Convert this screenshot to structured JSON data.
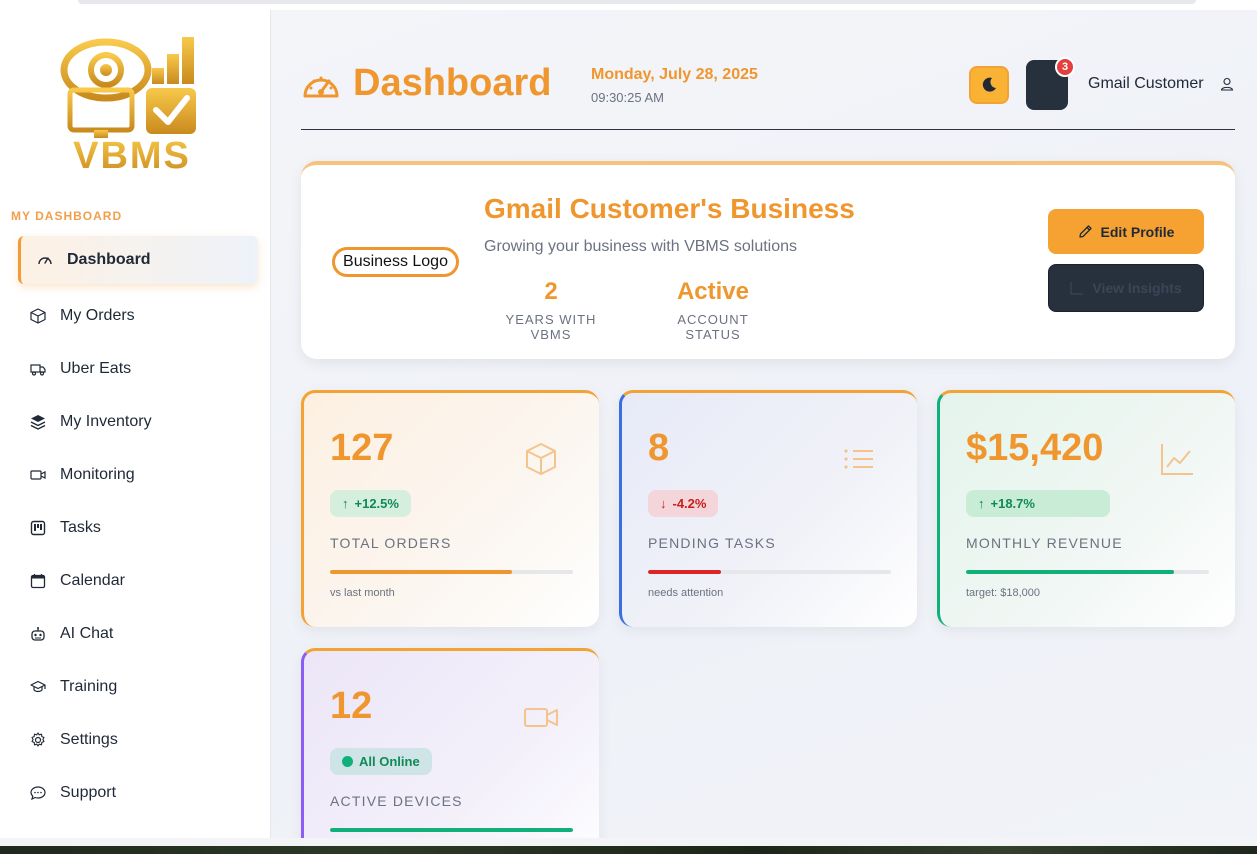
{
  "brand": {
    "name": "VBMS"
  },
  "sidebar": {
    "section_title": "MY DASHBOARD",
    "items": [
      {
        "label": "Dashboard",
        "icon": "gauge-icon",
        "active": true
      },
      {
        "label": "My Orders",
        "icon": "box-icon"
      },
      {
        "label": "Uber Eats",
        "icon": "truck-icon"
      },
      {
        "label": "My Inventory",
        "icon": "layers-icon"
      },
      {
        "label": "Monitoring",
        "icon": "video-icon"
      },
      {
        "label": "Tasks",
        "icon": "kanban-icon"
      },
      {
        "label": "Calendar",
        "icon": "calendar-icon"
      },
      {
        "label": "AI Chat",
        "icon": "robot-icon"
      },
      {
        "label": "Training",
        "icon": "graduation-cap-icon"
      },
      {
        "label": "Settings",
        "icon": "gear-icon"
      },
      {
        "label": "Support",
        "icon": "chat-bubble-icon"
      }
    ]
  },
  "header": {
    "title": "Dashboard",
    "date": "Monday, July 28, 2025",
    "time": "09:30:25 AM",
    "notification_count": "3",
    "user_name": "Gmail Customer"
  },
  "profile": {
    "logo_alt": "Business Logo",
    "business_name": "Gmail Customer's Business",
    "tagline": "Growing your business with VBMS solutions",
    "stats": [
      {
        "value": "2",
        "label": "YEARS WITH VBMS"
      },
      {
        "value": "Active",
        "label": "ACCOUNT STATUS"
      }
    ],
    "edit_label": "Edit Profile",
    "view_label": "View Insights"
  },
  "cards": {
    "orders": {
      "value": "127",
      "change": "+12.5%",
      "label": "TOTAL ORDERS",
      "sub": "vs last month",
      "progress": 0.75
    },
    "tasks": {
      "value": "8",
      "change": "-4.2%",
      "label": "PENDING TASKS",
      "sub": "needs attention",
      "progress": 0.3
    },
    "revenue": {
      "value": "$15,420",
      "change": "+18.7%",
      "label": "MONTHLY REVENUE",
      "sub": "target: $18,000",
      "progress": 0.857
    },
    "devices": {
      "value": "12",
      "badge": "All Online",
      "label": "ACTIVE DEVICES",
      "progress": 1.0
    }
  },
  "colors": {
    "accent": "#f0962e",
    "dark": "#27313d",
    "positive": "#10b07a",
    "negative": "#dc2626",
    "purple": "#8b5cf6",
    "blue": "#3b6fe0"
  }
}
